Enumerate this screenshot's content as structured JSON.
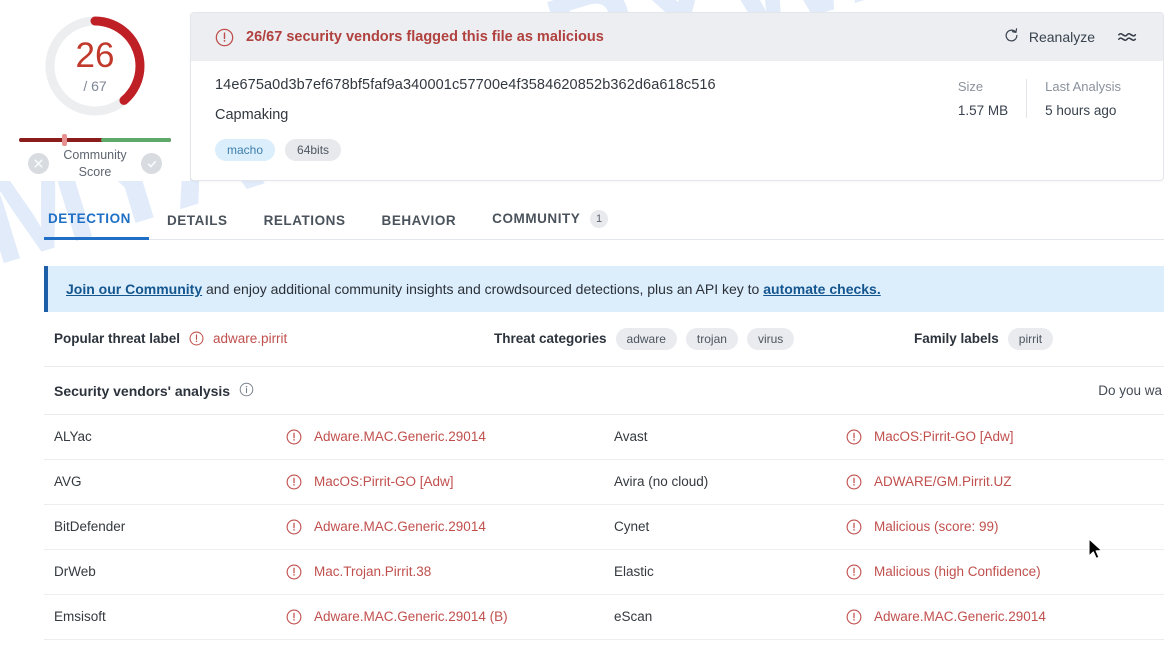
{
  "watermark": "MYANTISPYWARE.COM",
  "gauge": {
    "detections": "26",
    "total": "/ 67",
    "ratio": 0.388,
    "arc_color": "#bf2026",
    "track_color": "#eceef0"
  },
  "community_score": {
    "label_line1": "Community",
    "label_line2": "Score",
    "negative_icon": "close-circle-icon",
    "positive_icon": "check-circle-icon",
    "bar_red": "#8b1c1c",
    "bar_green": "#5fa96b"
  },
  "verdict": {
    "icon": "warning-circle-icon",
    "text": "26/67 security vendors flagged this file as malicious",
    "color": "#b0413e"
  },
  "header_actions": {
    "reanalyze_label": "Reanalyze",
    "reanalyze_icon": "refresh-icon",
    "similar_icon": "similar-waves-icon"
  },
  "file": {
    "hash": "14e675a0d3b7ef678bf5faf9a340001c57700e4f3584620852b362d6a618c516",
    "name": "Capmaking",
    "tags": [
      {
        "label": "macho",
        "style": "blue"
      },
      {
        "label": "64bits",
        "style": "grey"
      }
    ]
  },
  "meta": [
    {
      "key": "Size",
      "value": "1.57 MB"
    },
    {
      "key": "Last Analysis",
      "value": "5 hours ago"
    }
  ],
  "tabs": [
    {
      "label": "DETECTION",
      "active": true,
      "badge": ""
    },
    {
      "label": "DETAILS",
      "active": false,
      "badge": ""
    },
    {
      "label": "RELATIONS",
      "active": false,
      "badge": ""
    },
    {
      "label": "BEHAVIOR",
      "active": false,
      "badge": ""
    },
    {
      "label": "COMMUNITY",
      "active": false,
      "badge": "1"
    }
  ],
  "banner": {
    "link1": "Join our Community",
    "middle": " and enjoy additional community insights and crowdsourced detections, plus an API key to ",
    "link2": "automate checks."
  },
  "threat_strip": {
    "popular_key": "Popular threat label",
    "popular_value": "adware.pirrit",
    "categories_key": "Threat categories",
    "categories": [
      "adware",
      "trojan",
      "virus"
    ],
    "family_key": "Family labels",
    "family": [
      "pirrit"
    ]
  },
  "vendors_header": {
    "title": "Security vendors' analysis",
    "info_icon": "info-circle-icon",
    "right_text": "Do you wa"
  },
  "vendors": [
    {
      "left": {
        "name": "ALYac",
        "result": "Adware.MAC.Generic.29014"
      },
      "right": {
        "name": "Avast",
        "result": "MacOS:Pirrit-GO [Adw]"
      }
    },
    {
      "left": {
        "name": "AVG",
        "result": "MacOS:Pirrit-GO [Adw]"
      },
      "right": {
        "name": "Avira (no cloud)",
        "result": "ADWARE/GM.Pirrit.UZ"
      }
    },
    {
      "left": {
        "name": "BitDefender",
        "result": "Adware.MAC.Generic.29014"
      },
      "right": {
        "name": "Cynet",
        "result": "Malicious (score: 99)"
      }
    },
    {
      "left": {
        "name": "DrWeb",
        "result": "Mac.Trojan.Pirrit.38"
      },
      "right": {
        "name": "Elastic",
        "result": "Malicious (high Confidence)"
      }
    },
    {
      "left": {
        "name": "Emsisoft",
        "result": "Adware.MAC.Generic.29014 (B)"
      },
      "right": {
        "name": "eScan",
        "result": "Adware.MAC.Generic.29014"
      }
    }
  ]
}
